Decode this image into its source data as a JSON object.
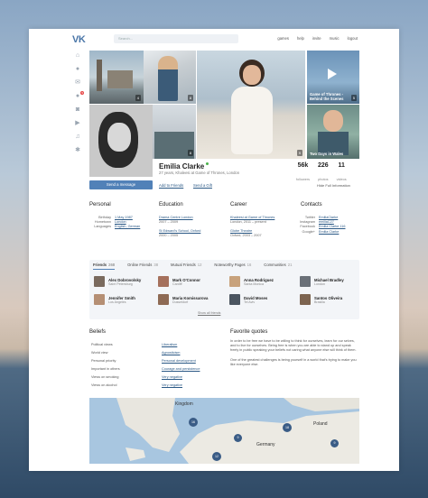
{
  "header": {
    "logo": "VK",
    "search_placeholder": "Search...",
    "nav": [
      "games",
      "help",
      "invite",
      "music",
      "logout"
    ]
  },
  "sidebar": {
    "icons": [
      "home-icon",
      "user-icon",
      "chat-icon",
      "notifications-icon",
      "camera-icon",
      "video-icon",
      "music-icon",
      "settings-icon"
    ],
    "badge": "5"
  },
  "photos": {
    "p1_likes": "4",
    "p2_likes": "8",
    "p3_likes": "9",
    "p4_likes": "5",
    "p5_likes": "8",
    "p4_caption": "Game of Thrones - Behind the Scenes",
    "p6_caption": "Two Days in Wales"
  },
  "profile": {
    "name": "Emilia Clarke",
    "subtitle": "27 years, Khaleesi at Game of Thrones, London",
    "followers": "56k",
    "followers_label": "followers",
    "photos_count": "226",
    "photos_label": "photos",
    "videos_count": "11",
    "videos_label": "videos",
    "send_message": "Send a message",
    "add_friends": "Add to Friends",
    "send_gift": "Send a Gift",
    "hide_full": "Hide Full Information"
  },
  "personal": {
    "title": "Personal",
    "rows": [
      {
        "k": "Birthday",
        "v": "1 May 1987"
      },
      {
        "k": "Hometown",
        "v": "London"
      },
      {
        "k": "Languages",
        "v": "English, German"
      }
    ]
  },
  "education": {
    "title": "Education",
    "rows": [
      {
        "v": "Drama Centre London",
        "s": "2007 – 2009"
      },
      {
        "v": "St Edward's School, Oxford",
        "s": "2000 – 2005"
      }
    ]
  },
  "career": {
    "title": "Career",
    "rows": [
      {
        "v": "Khaleesi at Game of Thrones",
        "s": "London, 2011 – present"
      },
      {
        "v": "Globe Theatre",
        "s": "Oxford, 2003 – 2007"
      }
    ]
  },
  "contacts": {
    "title": "Contacts",
    "rows": [
      {
        "k": "Twitter",
        "v": "EmiliaClarke"
      },
      {
        "k": "Instagram",
        "v": "emiliaC27"
      },
      {
        "k": "Facebook",
        "v": "Emilia Clarke 116"
      },
      {
        "k": "Google+",
        "v": "Emilia Clarke"
      }
    ]
  },
  "friends": {
    "tabs": [
      {
        "label": "Friends",
        "count": "268"
      },
      {
        "label": "Online Friends",
        "count": "38"
      },
      {
        "label": "Mutual Friends",
        "count": "12"
      },
      {
        "label": "Noteworthy Pages",
        "count": "16"
      },
      {
        "label": "Communities",
        "count": "21"
      }
    ],
    "list": [
      {
        "name": "Alex Dobrovolsky",
        "city": "Saint Petersburg"
      },
      {
        "name": "Mark O'Connor",
        "city": "Cardiff"
      },
      {
        "name": "Anna Rodriguez",
        "city": "Santa Monica"
      },
      {
        "name": "Michael Bradley",
        "city": "London"
      },
      {
        "name": "Jennifer Smith",
        "city": "Los Angeles"
      },
      {
        "name": "Maria Komissarova",
        "city": "Dusseldorf"
      },
      {
        "name": "David Moses",
        "city": "Tel Aviv"
      },
      {
        "name": "Santos Oliveira",
        "city": "Brasilia"
      }
    ],
    "show_all": "Show all friends"
  },
  "beliefs": {
    "title": "Beliefs",
    "rows": [
      {
        "k": "Political views",
        "v": "Liberalism"
      },
      {
        "k": "World view",
        "v": "Agnosticism"
      },
      {
        "k": "Personal priority",
        "v": "Personal development"
      },
      {
        "k": "Important in others",
        "v": "Courage and persistence"
      },
      {
        "k": "Views on smoking",
        "v": "Very negative"
      },
      {
        "k": "Views on alcohol",
        "v": "Very negative"
      }
    ]
  },
  "quotes": {
    "title": "Favorite quotes",
    "p1": "In order to be free we have to be willing to think for ourselves, learn for our selves, and to live for ourselves. Being free is when you are able to stand up and speak freely in public speaking your beliefs not caring what anyone else will think of them.",
    "p2": "One of the greatest challenges is being yourself in a world that's trying to make you like everyone else."
  },
  "map": {
    "labels": [
      "Kingdom",
      "Poland",
      "Germany"
    ],
    "markers": [
      "16",
      "9",
      "18",
      "12",
      "9"
    ]
  }
}
